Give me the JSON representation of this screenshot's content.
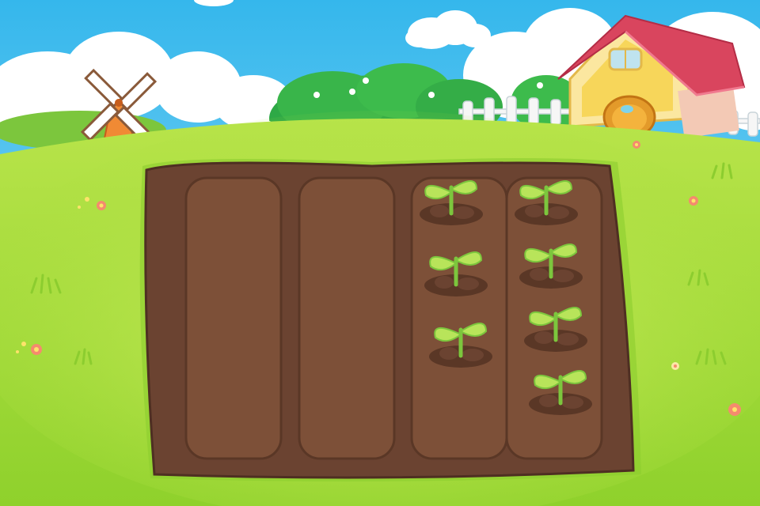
{
  "scene": {
    "type": "farm-garden-game",
    "sky_color": "#5ec8f0",
    "grass_color": "#a6dc3a",
    "soil_color": "#6b4331",
    "roof_color": "#d9455e"
  },
  "background": {
    "windmill_icon": "windmill-icon",
    "house_icon": "cottage-icon",
    "fence_icon": "picket-fence-icon",
    "flower_icon": "flower-icon"
  },
  "garden": {
    "rows": [
      {
        "planted": false,
        "sprouts": 0
      },
      {
        "planted": false,
        "sprouts": 0
      },
      {
        "planted": true,
        "sprouts": 3
      },
      {
        "planted": true,
        "sprouts": 4
      }
    ],
    "sprout_icon": "seedling-icon",
    "total_sprouts": 7
  }
}
